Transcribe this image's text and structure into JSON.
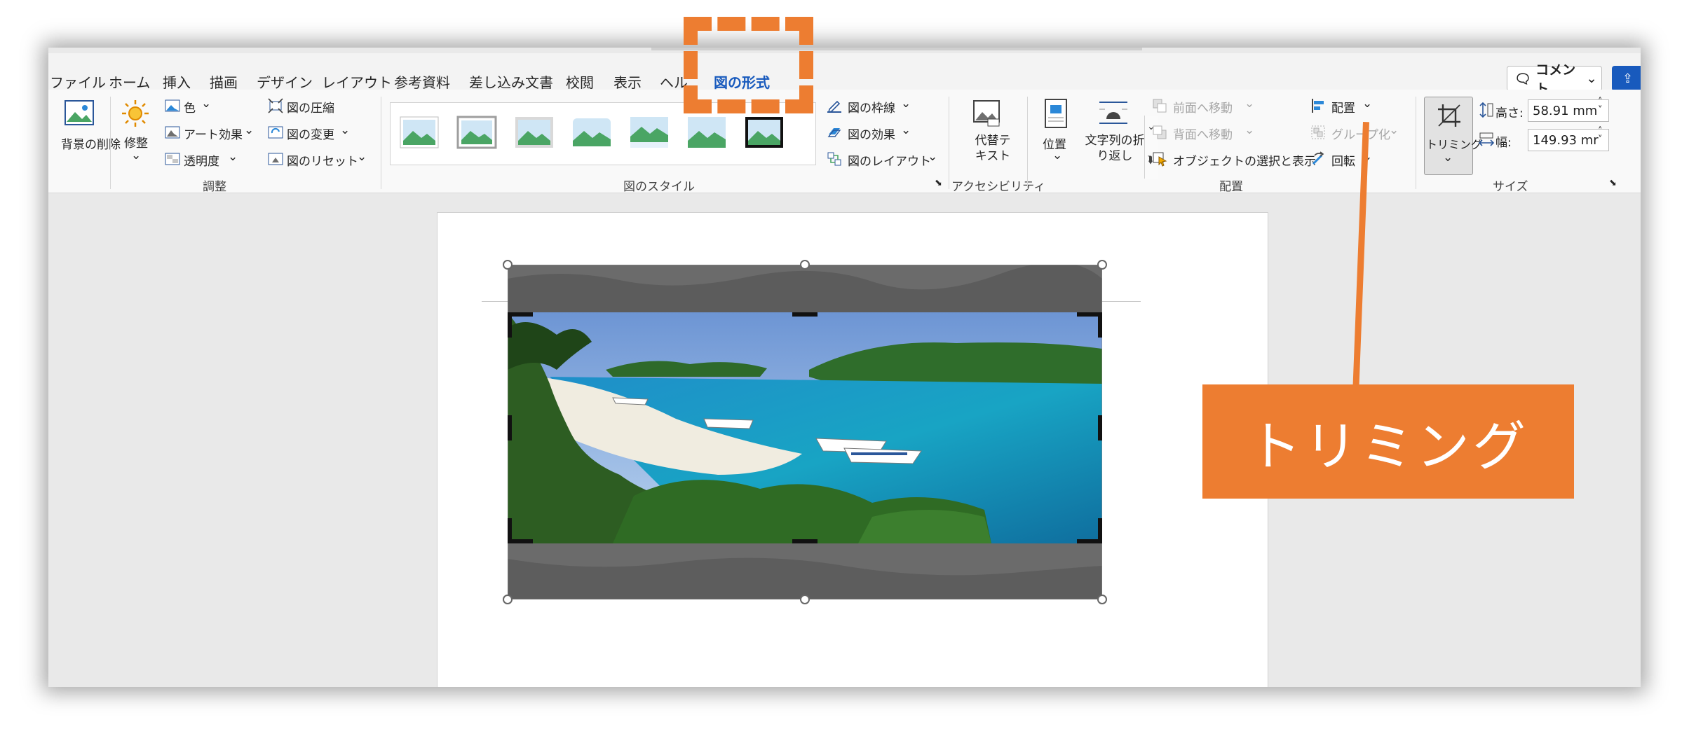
{
  "colors": {
    "accent": "#185abd",
    "callout": "#ed7d31",
    "dim": "#6b6b6b"
  },
  "tabs": [
    "ファイル",
    "ホーム",
    "挿入",
    "描画",
    "デザイン",
    "レイアウト",
    "参考資料",
    "差し込み文書",
    "校閲",
    "表示",
    "ヘル",
    "図の形式"
  ],
  "active_tab": "図の形式",
  "header": {
    "comment_label": "コメント",
    "share_icon": "share-icon"
  },
  "ribbon": {
    "adjust": {
      "remove_bg": "背景の削除",
      "corrections": "修整",
      "color": "色",
      "art_effects": "アート効果",
      "transparency": "透明度",
      "compress": "図の圧縮",
      "change": "図の変更",
      "reset": "図のリセット",
      "label": "調整"
    },
    "styles": {
      "border": "図の枠線",
      "effects": "図の効果",
      "layout": "図のレイアウト",
      "label": "図のスタイル"
    },
    "accessibility": {
      "alt_text": "代替テキスト",
      "label": "アクセシビリティ"
    },
    "arrange": {
      "position": "位置",
      "wrap_text": "文字列の折り返し",
      "bring_forward": "前面へ移動",
      "send_backward": "背面へ移動",
      "selection_pane": "オブジェクトの選択と表示",
      "align": "配置",
      "group": "グループ化",
      "rotate": "回転",
      "label": "配置"
    },
    "size": {
      "crop": "トリミング",
      "height_label": "高さ:",
      "height_value": "58.91 mm",
      "width_label": "幅:",
      "width_value": "149.93 mr",
      "label": "サイズ"
    }
  },
  "callout": {
    "text": "トリミング"
  }
}
